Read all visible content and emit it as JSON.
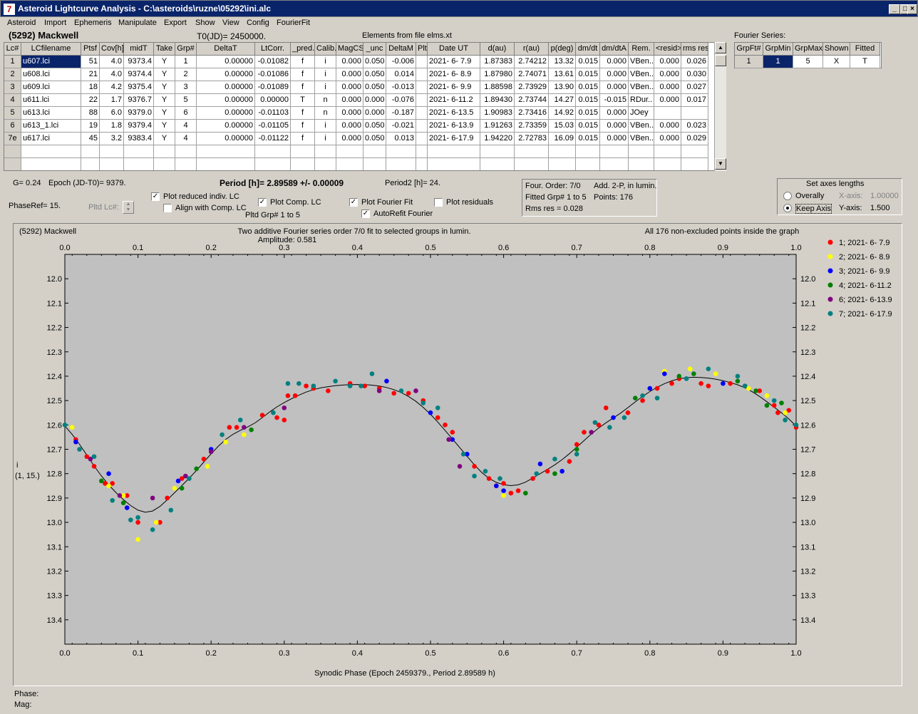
{
  "window": {
    "title": "Asteroid Lightcurve Analysis - C:\\asteroids\\ruzne\\05292\\ini.alc",
    "buttons": [
      "_",
      "□",
      "×"
    ]
  },
  "menu": [
    "Asteroid",
    "Import",
    "Ephemeris",
    "Manipulate",
    "Export",
    "Show",
    "View",
    "Config",
    "FourierFit"
  ],
  "header": {
    "asteroid": "(5292) Mackwell",
    "t0": "T0(JD)= 2450000.",
    "elements": "Elements from file elms.xt"
  },
  "table": {
    "columns": [
      "Lc#",
      "LCfilename",
      "Ptsf",
      "Cov[h]",
      "midT",
      "Take",
      "Grp#",
      "DeltaT",
      "LtCorr.",
      "_pred.",
      "Calib.",
      "MagCS",
      "_unc",
      "DeltaM",
      "Plt",
      "Date UT",
      "d(au)",
      "r(au)",
      "p(deg)",
      "dm/dt",
      "dm/dtA",
      "Rem.",
      "<resid>",
      "rms res"
    ],
    "rows": [
      [
        "1",
        "u607.lci",
        "51",
        "4.0",
        "9373.4",
        "Y",
        "1",
        "0.00000",
        "-0.01082",
        "f",
        "i",
        "0.000",
        "0.050",
        "-0.006",
        "",
        "2021- 6- 7.9",
        "1.87383",
        "2.74212",
        "13.32",
        "0.015",
        "0.000",
        "VBen..",
        "0.000",
        "0.026"
      ],
      [
        "2",
        "u608.lci",
        "21",
        "4.0",
        "9374.4",
        "Y",
        "2",
        "0.00000",
        "-0.01086",
        "f",
        "i",
        "0.000",
        "0.050",
        "0.014",
        "",
        "2021- 6- 8.9",
        "1.87980",
        "2.74071",
        "13.61",
        "0.015",
        "0.000",
        "VBen..",
        "0.000",
        "0.030"
      ],
      [
        "3",
        "u609.lci",
        "18",
        "4.2",
        "9375.4",
        "Y",
        "3",
        "0.00000",
        "-0.01089",
        "f",
        "i",
        "0.000",
        "0.050",
        "-0.013",
        "",
        "2021- 6- 9.9",
        "1.88598",
        "2.73929",
        "13.90",
        "0.015",
        "0.000",
        "VBen..",
        "0.000",
        "0.027"
      ],
      [
        "4",
        "u611.lci",
        "22",
        "1.7",
        "9376.7",
        "Y",
        "5",
        "0.00000",
        "0.00000",
        "T",
        "n",
        "0.000",
        "0.000",
        "-0.076",
        "",
        "2021- 6-11.2",
        "1.89430",
        "2.73744",
        "14.27",
        "0.015",
        "-0.015",
        "RDur..",
        "0.000",
        "0.017"
      ],
      [
        "5",
        "u613.lci",
        "88",
        "6.0",
        "9379.0",
        "Y",
        "6",
        "0.00000",
        "-0.01103",
        "f",
        "n",
        "0.000",
        "0.000",
        "-0.187",
        "",
        "2021- 6-13.5",
        "1.90983",
        "2.73416",
        "14.92",
        "0.015",
        "0.000",
        "JOey",
        "",
        ""
      ],
      [
        "6",
        "u613_1.lci",
        "19",
        "1.8",
        "9379.4",
        "Y",
        "4",
        "0.00000",
        "-0.01105",
        "f",
        "i",
        "0.000",
        "0.050",
        "-0.021",
        "",
        "2021- 6-13.9",
        "1.91263",
        "2.73359",
        "15.03",
        "0.015",
        "0.000",
        "VBen..",
        "0.000",
        "0.023"
      ],
      [
        "7e",
        "u617.lci",
        "45",
        "3.2",
        "9383.4",
        "Y",
        "4",
        "0.00000",
        "-0.01122",
        "f",
        "i",
        "0.000",
        "0.050",
        "0.013",
        "",
        "2021- 6-17.9",
        "1.94220",
        "2.72783",
        "16.09",
        "0.015",
        "0.000",
        "VBen..",
        "0.000",
        "0.029"
      ]
    ]
  },
  "fourier_series": {
    "label": "Fourier Series:",
    "columns": [
      "GrpFt#",
      "GrpMin",
      "GrpMax",
      "Shown",
      "Fitted"
    ],
    "row": [
      "1",
      "1",
      "5",
      "X",
      "T"
    ]
  },
  "info": {
    "g": "G= 0.24",
    "epoch": "Epoch (JD-T0)= 9379.",
    "period": "Period [h]= 2.89589 +/- 0.00009",
    "period2": "Period2 [h]= 24.",
    "phaseref": "PhaseRef= 15.",
    "pltd_lc": "Pltd Lc#:",
    "pltd_grp": "Pltd Grp#  1   to   5"
  },
  "checkboxes": {
    "reduced": {
      "label": "Plot reduced indiv. LC",
      "checked": true
    },
    "align": {
      "label": "Align with Comp. LC",
      "checked": false
    },
    "comp": {
      "label": "Plot Comp. LC",
      "checked": true
    },
    "fourier": {
      "label": "Plot Fourier Fit",
      "checked": true
    },
    "residuals": {
      "label": "Plot residuals",
      "checked": false
    },
    "autorefit": {
      "label": "AutoRefit Fourier",
      "checked": true
    }
  },
  "fit_info": {
    "order": "Four. Order:  7/0",
    "add": "Add. 2-P, in lumin.",
    "fitted": "Fitted Grp# 1 to 5",
    "points": "Points: 176",
    "rms": "Rms res     = 0.028"
  },
  "axes_panel": {
    "title": "Set axes lengths",
    "overally": "Overally",
    "keep": "Keep Axis",
    "xaxis_label": "X-axis:",
    "xaxis_value": "1.00000",
    "yaxis_label": "Y-axis:",
    "yaxis_value": "1.500"
  },
  "status": {
    "phase": "Phase:",
    "mag": "Mag:"
  },
  "chart_data": {
    "type": "scatter",
    "title": "Two additive Fourier series order 7/0 fit to selected groups in lumin.",
    "subtitle": "Amplitude: 0.581",
    "object_label": "(5292) Mackwell",
    "note": "All 176 non-excluded points inside the graph",
    "xlabel": "Synodic Phase (Epoch 2459379., Period 2.89589 h)",
    "ylabel": "i",
    "ylabel2": "(1, 15.)",
    "xlim": [
      0,
      1
    ],
    "ylim": [
      12.0,
      13.5
    ],
    "y_inverted": true,
    "xticks": [
      "0.0",
      "0.1",
      "0.2",
      "0.3",
      "0.4",
      "0.5",
      "0.6",
      "0.7",
      "0.8",
      "0.9",
      "1.0"
    ],
    "yticks": [
      "12.0",
      "12.1",
      "12.2",
      "12.3",
      "12.4",
      "12.5",
      "12.6",
      "12.7",
      "12.8",
      "12.9",
      "13.0",
      "13.1",
      "13.2",
      "13.3",
      "13.4"
    ],
    "legend_position": "right",
    "series": [
      {
        "name": "1; 2021- 6- 7.9",
        "color": "#ff0000",
        "points": [
          [
            0.015,
            12.66
          ],
          [
            0.03,
            12.73
          ],
          [
            0.04,
            12.77
          ],
          [
            0.055,
            12.84
          ],
          [
            0.065,
            12.84
          ],
          [
            0.085,
            12.89
          ],
          [
            0.1,
            13.0
          ],
          [
            0.13,
            13.0
          ],
          [
            0.14,
            12.9
          ],
          [
            0.16,
            12.82
          ],
          [
            0.19,
            12.74
          ],
          [
            0.225,
            12.61
          ],
          [
            0.235,
            12.61
          ],
          [
            0.27,
            12.56
          ],
          [
            0.29,
            12.57
          ],
          [
            0.3,
            12.58
          ],
          [
            0.305,
            12.48
          ],
          [
            0.315,
            12.48
          ],
          [
            0.33,
            12.44
          ],
          [
            0.34,
            12.45
          ],
          [
            0.36,
            12.46
          ],
          [
            0.39,
            12.43
          ],
          [
            0.41,
            12.44
          ],
          [
            0.43,
            12.45
          ],
          [
            0.45,
            12.47
          ],
          [
            0.47,
            12.47
          ],
          [
            0.49,
            12.5
          ],
          [
            0.51,
            12.57
          ],
          [
            0.52,
            12.6
          ],
          [
            0.53,
            12.63
          ],
          [
            0.56,
            12.77
          ],
          [
            0.58,
            12.82
          ],
          [
            0.59,
            12.85
          ],
          [
            0.6,
            12.84
          ],
          [
            0.61,
            12.88
          ],
          [
            0.62,
            12.87
          ],
          [
            0.64,
            12.82
          ],
          [
            0.66,
            12.79
          ],
          [
            0.69,
            12.75
          ],
          [
            0.7,
            12.68
          ],
          [
            0.71,
            12.63
          ],
          [
            0.73,
            12.6
          ],
          [
            0.74,
            12.53
          ],
          [
            0.77,
            12.55
          ],
          [
            0.79,
            12.5
          ],
          [
            0.81,
            12.45
          ],
          [
            0.83,
            12.43
          ],
          [
            0.84,
            12.41
          ],
          [
            0.87,
            12.43
          ],
          [
            0.88,
            12.44
          ],
          [
            0.91,
            12.43
          ],
          [
            0.93,
            12.44
          ],
          [
            0.95,
            12.46
          ],
          [
            0.97,
            12.52
          ],
          [
            0.975,
            12.55
          ],
          [
            0.99,
            12.54
          ],
          [
            1.0,
            12.61
          ]
        ]
      },
      {
        "name": "2; 2021- 6- 8.9",
        "color": "#ffff00",
        "points": [
          [
            0.01,
            12.61
          ],
          [
            0.06,
            12.85
          ],
          [
            0.08,
            12.89
          ],
          [
            0.1,
            13.07
          ],
          [
            0.125,
            13.0
          ],
          [
            0.15,
            12.86
          ],
          [
            0.195,
            12.77
          ],
          [
            0.22,
            12.67
          ],
          [
            0.245,
            12.64
          ],
          [
            0.82,
            12.38
          ],
          [
            0.855,
            12.37
          ],
          [
            0.89,
            12.39
          ],
          [
            0.935,
            12.45
          ],
          [
            0.96,
            12.48
          ],
          [
            0.985,
            12.55
          ],
          [
            0.6,
            12.89
          ]
        ]
      },
      {
        "name": "3; 2021- 6- 9.9",
        "color": "#0000ff",
        "points": [
          [
            0.015,
            12.67
          ],
          [
            0.06,
            12.8
          ],
          [
            0.085,
            12.94
          ],
          [
            0.155,
            12.83
          ],
          [
            0.2,
            12.7
          ],
          [
            0.44,
            12.42
          ],
          [
            0.5,
            12.55
          ],
          [
            0.53,
            12.66
          ],
          [
            0.55,
            12.72
          ],
          [
            0.59,
            12.85
          ],
          [
            0.6,
            12.87
          ],
          [
            0.65,
            12.76
          ],
          [
            0.68,
            12.79
          ],
          [
            0.75,
            12.57
          ],
          [
            0.8,
            12.45
          ],
          [
            0.82,
            12.39
          ],
          [
            0.9,
            12.43
          ]
        ]
      },
      {
        "name": "4; 2021- 6-11.2",
        "color": "#008000",
        "points": [
          [
            0.05,
            12.83
          ],
          [
            0.08,
            12.92
          ],
          [
            0.16,
            12.86
          ],
          [
            0.18,
            12.78
          ],
          [
            0.255,
            12.62
          ],
          [
            0.63,
            12.88
          ],
          [
            0.67,
            12.8
          ],
          [
            0.7,
            12.7
          ],
          [
            0.78,
            12.49
          ],
          [
            0.84,
            12.4
          ],
          [
            0.86,
            12.39
          ],
          [
            0.92,
            12.42
          ],
          [
            0.945,
            12.46
          ],
          [
            0.96,
            12.52
          ],
          [
            0.98,
            12.51
          ]
        ]
      },
      {
        "name": "6; 2021- 6-13.9",
        "color": "#800080",
        "points": [
          [
            0.035,
            12.74
          ],
          [
            0.075,
            12.89
          ],
          [
            0.12,
            12.9
          ],
          [
            0.165,
            12.81
          ],
          [
            0.2,
            12.71
          ],
          [
            0.245,
            12.61
          ],
          [
            0.3,
            12.53
          ],
          [
            0.43,
            12.46
          ],
          [
            0.48,
            12.46
          ],
          [
            0.525,
            12.66
          ],
          [
            0.54,
            12.77
          ],
          [
            0.72,
            12.63
          ]
        ]
      },
      {
        "name": "7; 2021- 6-17.9",
        "color": "#008080",
        "points": [
          [
            0.0,
            12.6
          ],
          [
            0.02,
            12.7
          ],
          [
            0.04,
            12.73
          ],
          [
            0.065,
            12.91
          ],
          [
            0.09,
            12.99
          ],
          [
            0.1,
            12.98
          ],
          [
            0.12,
            13.03
          ],
          [
            0.145,
            12.95
          ],
          [
            0.17,
            12.82
          ],
          [
            0.215,
            12.64
          ],
          [
            0.24,
            12.58
          ],
          [
            0.285,
            12.55
          ],
          [
            0.305,
            12.43
          ],
          [
            0.32,
            12.43
          ],
          [
            0.34,
            12.44
          ],
          [
            0.37,
            12.42
          ],
          [
            0.39,
            12.44
          ],
          [
            0.405,
            12.44
          ],
          [
            0.42,
            12.39
          ],
          [
            0.46,
            12.46
          ],
          [
            0.49,
            12.51
          ],
          [
            0.51,
            12.53
          ],
          [
            0.545,
            12.72
          ],
          [
            0.56,
            12.81
          ],
          [
            0.575,
            12.79
          ],
          [
            0.595,
            12.82
          ],
          [
            0.645,
            12.8
          ],
          [
            0.67,
            12.74
          ],
          [
            0.7,
            12.72
          ],
          [
            0.725,
            12.59
          ],
          [
            0.745,
            12.61
          ],
          [
            0.765,
            12.57
          ],
          [
            0.79,
            12.48
          ],
          [
            0.81,
            12.49
          ],
          [
            0.85,
            12.41
          ],
          [
            0.88,
            12.37
          ],
          [
            0.92,
            12.4
          ],
          [
            0.93,
            12.44
          ],
          [
            0.97,
            12.5
          ],
          [
            0.985,
            12.58
          ],
          [
            1.0,
            12.6
          ]
        ]
      }
    ]
  }
}
